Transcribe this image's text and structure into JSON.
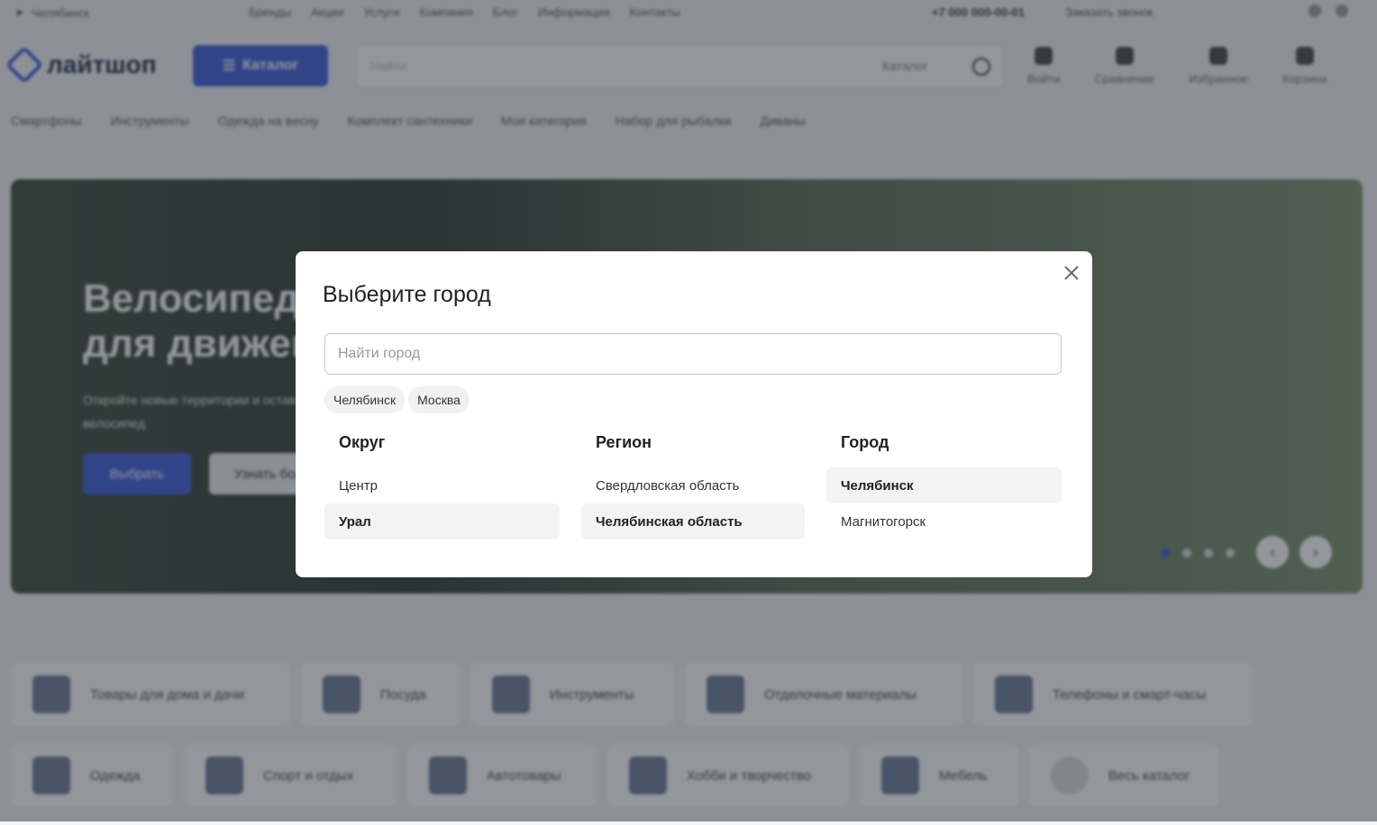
{
  "topbar": {
    "city": "Челябинск",
    "nav": [
      "Бренды",
      "Акции",
      "Услуги",
      "Компания",
      "Блог",
      "Информация",
      "Контакты"
    ],
    "phone": "+7 000 000-00-01",
    "callback": "Заказать звонок"
  },
  "header": {
    "logo": "лайтшоп",
    "catalog_label": "Каталог",
    "search_placeholder": "Найти",
    "search_scope": "Каталог",
    "icons": [
      {
        "label": "Войти",
        "icon": "user-icon"
      },
      {
        "label": "Сравнение",
        "icon": "compare-icon"
      },
      {
        "label": "Избранное",
        "icon": "heart-icon"
      },
      {
        "label": "Корзина",
        "icon": "cart-icon"
      }
    ]
  },
  "categories": [
    "Смартфоны",
    "Инструменты",
    "Одежда на весну",
    "Комплект сантехники",
    "Моя категория",
    "Набор для рыбалки",
    "Диваны"
  ],
  "hero": {
    "title": "Велосипеды\nдля движения",
    "text": "Откройте новые территории и оставайтесь на ходу — найдется велосипед",
    "primary_button": "Выбрать",
    "secondary_button": "Узнать больше"
  },
  "tiles_row1": [
    "Товары для дома и дачи",
    "Посуда",
    "Инструменты",
    "Отделочные материалы",
    "Телефоны и смарт-часы"
  ],
  "tiles_row2": [
    "Одежда",
    "Спорт и отдых",
    "Автотовары",
    "Хобби и творчество",
    "Мебель",
    "Весь каталог"
  ],
  "modal": {
    "title": "Выберите город",
    "search_placeholder": "Найти город",
    "quick_cities": [
      "Челябинск",
      "Москва"
    ],
    "columns": {
      "district": {
        "title": "Округ",
        "items": [
          "Центр",
          "Урал"
        ],
        "selected": "Урал"
      },
      "region": {
        "title": "Регион",
        "items": [
          "Свердловская область",
          "Челябинская область"
        ],
        "selected": "Челябинская область"
      },
      "city": {
        "title": "Город",
        "items": [
          "Челябинск",
          "Магнитогорск"
        ],
        "selected": "Челябинск"
      }
    }
  },
  "colors": {
    "accent": "#3b5bdb",
    "overlay": "rgba(40,46,56,0.5)",
    "selected_bg": "#f3f3f3"
  }
}
